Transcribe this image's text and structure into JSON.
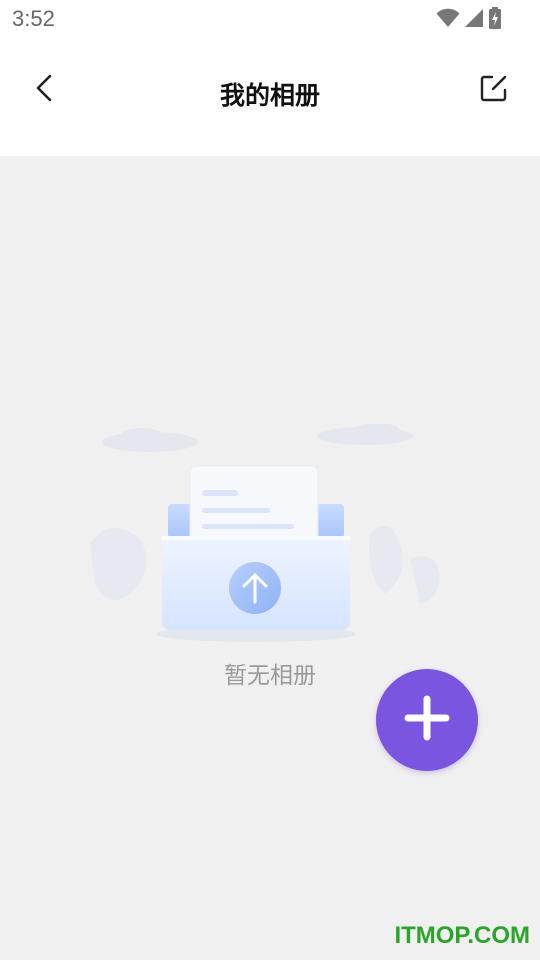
{
  "status_bar": {
    "time": "3:52",
    "icons": [
      "wifi-icon",
      "cellular-signal-icon",
      "battery-charging-icon"
    ]
  },
  "header": {
    "back_icon": "chevron-left-icon",
    "title": "我的相册",
    "edit_icon": "edit-icon"
  },
  "empty_state": {
    "illustration": "empty-folder-upload-illustration",
    "message": "暂无相册"
  },
  "fab": {
    "icon": "plus-icon",
    "color": "#7a55e0"
  },
  "watermark": {
    "text": "ITMOP.COM",
    "color": "#2aa52a"
  }
}
